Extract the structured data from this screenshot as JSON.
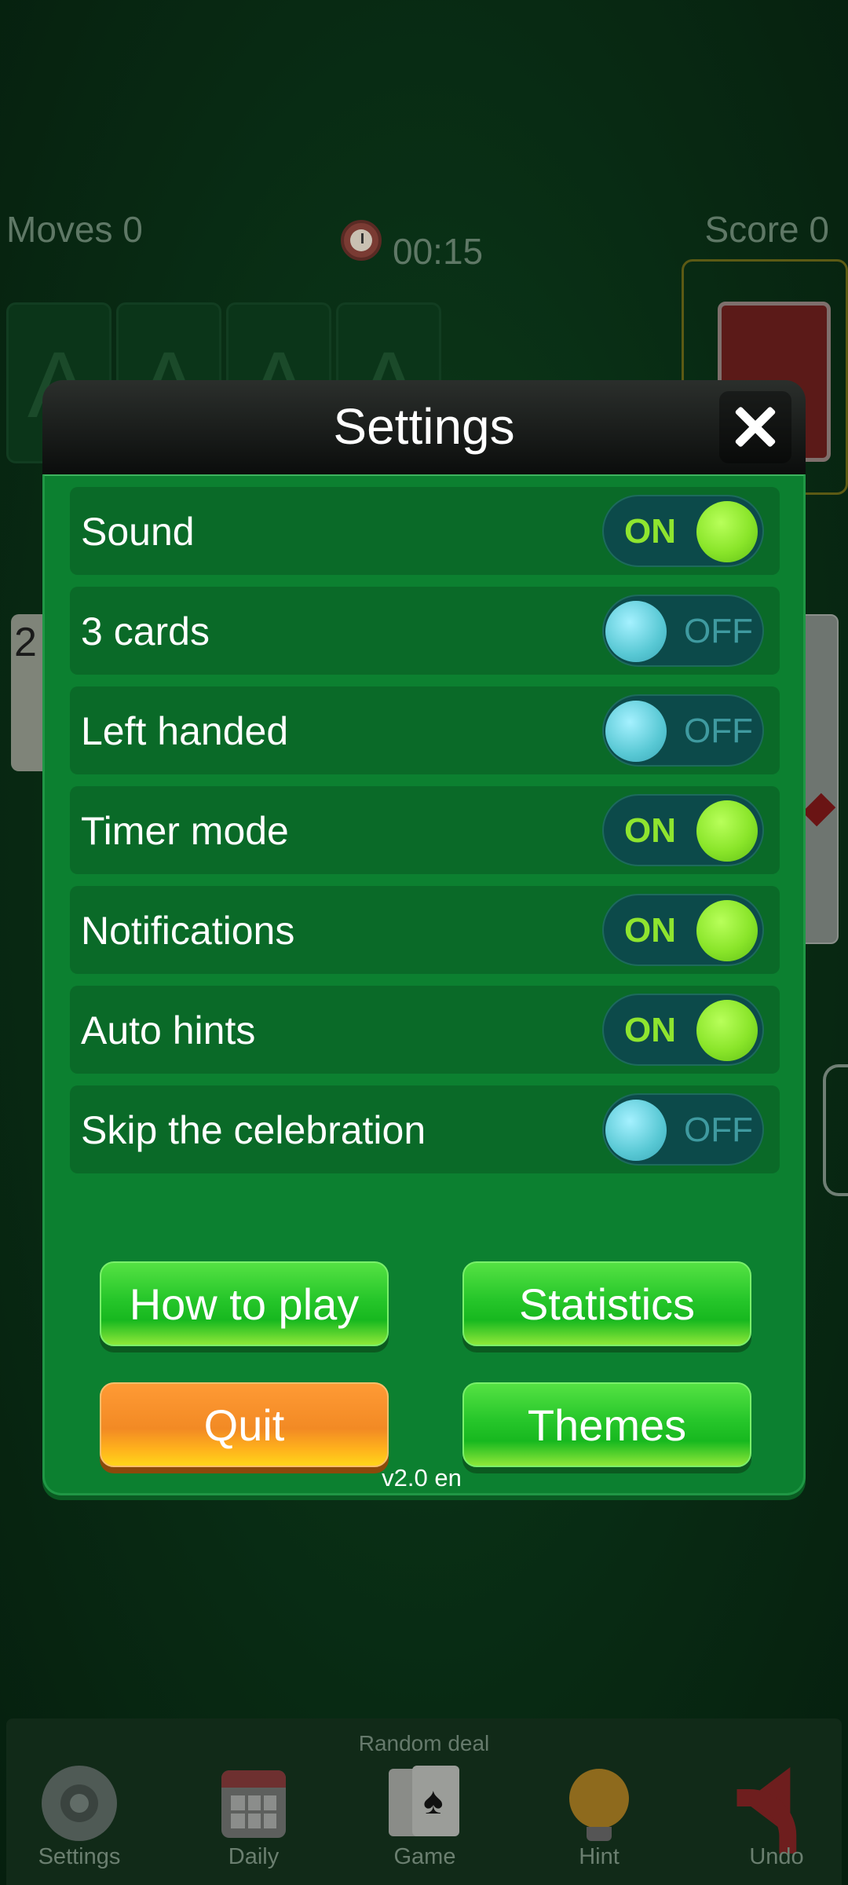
{
  "hud": {
    "moves": "Moves 0",
    "score": "Score 0",
    "timer": "00:15"
  },
  "foundation_placeholder": "A",
  "tableau_left_card": "2",
  "dialog": {
    "title": "Settings",
    "rows": [
      {
        "label": "Sound",
        "state": "ON"
      },
      {
        "label": "3 cards",
        "state": "OFF"
      },
      {
        "label": "Left handed",
        "state": "OFF"
      },
      {
        "label": "Timer mode",
        "state": "ON"
      },
      {
        "label": "Notifications",
        "state": "ON"
      },
      {
        "label": "Auto hints",
        "state": "ON"
      },
      {
        "label": "Skip the celebration",
        "state": "OFF"
      }
    ],
    "buttons": {
      "how_to_play": "How to play",
      "statistics": "Statistics",
      "quit": "Quit",
      "themes": "Themes"
    },
    "version": "v2.0 en"
  },
  "bottom_bar": {
    "caption": "Random deal",
    "items": [
      {
        "label": "Settings",
        "icon": "gear-icon"
      },
      {
        "label": "Daily",
        "icon": "calendar-icon"
      },
      {
        "label": "Game",
        "icon": "cards-icon"
      },
      {
        "label": "Hint",
        "icon": "lightbulb-icon"
      },
      {
        "label": "Undo",
        "icon": "undo-arrow-icon"
      }
    ]
  },
  "colors": {
    "dialog_green": "#0c8030",
    "toggle_on": "#8ae52a",
    "toggle_off": "#58c8d4",
    "quit_orange": "#f28a24"
  }
}
